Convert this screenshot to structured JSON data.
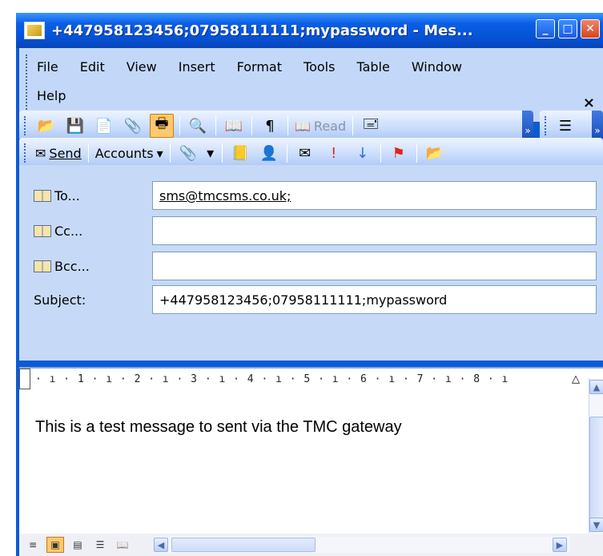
{
  "window": {
    "title": "+447958123456;07958111111;mypassword - Mes...",
    "controls": [
      "minimize",
      "maximize",
      "close"
    ]
  },
  "menu": {
    "items": [
      "File",
      "Edit",
      "View",
      "Insert",
      "Format",
      "Tools",
      "Table",
      "Window",
      "Help"
    ],
    "close_glyph": "×"
  },
  "toolbar1": {
    "read_label": "Read"
  },
  "toolbar2": {
    "send_label": "Send",
    "accounts_label": "Accounts"
  },
  "fields": {
    "to_label": "To...",
    "to_value": "sms@tmcsms.co.uk;",
    "cc_label": "Cc...",
    "cc_value": "",
    "bcc_label": "Bcc...",
    "bcc_value": "",
    "subject_label": "Subject:",
    "subject_value": "+447958123456;07958111111;mypassword"
  },
  "ruler": {
    "text": "· ı · 1 · ı · 2 · ı · 3 · ı · 4 · ı · 5 · ı · 6 · ı · 7 · ı · 8 · ı"
  },
  "body": {
    "text": "This is a test message to sent via the TMC gateway"
  },
  "colors": {
    "titlebar": "#0552d6",
    "chrome": "#c3d8f8",
    "active_button": "#ffc96b"
  }
}
